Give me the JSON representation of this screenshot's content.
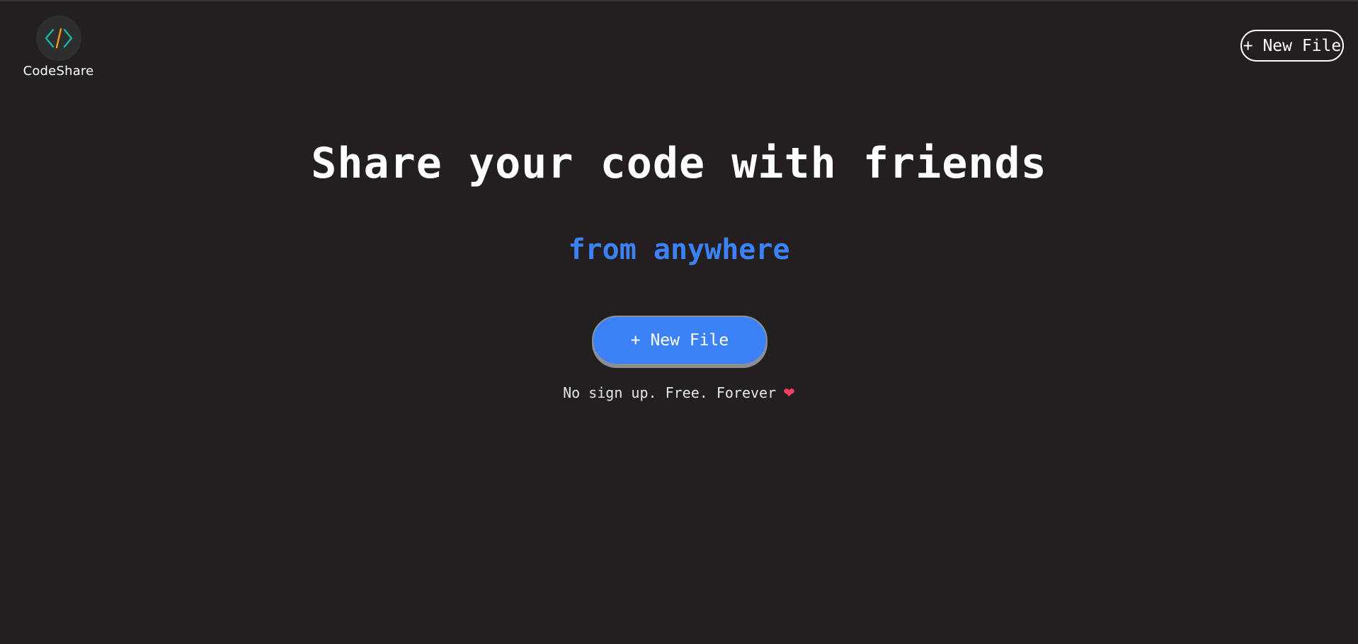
{
  "brand": {
    "name": "CodeShare",
    "icon": "code-brackets-icon"
  },
  "header": {
    "new_file_label": "+ New File"
  },
  "hero": {
    "headline": "Share your code with friends",
    "subhead": "from anywhere",
    "cta_label": "+ New File",
    "tagline": "No sign up. Free. Forever",
    "tagline_icon": "heart-icon"
  },
  "colors": {
    "background": "#231f20",
    "accent": "#3b82f6",
    "logo_teal": "#14b8a6",
    "logo_orange": "#f59e0b",
    "heart": "#f43f5e"
  }
}
